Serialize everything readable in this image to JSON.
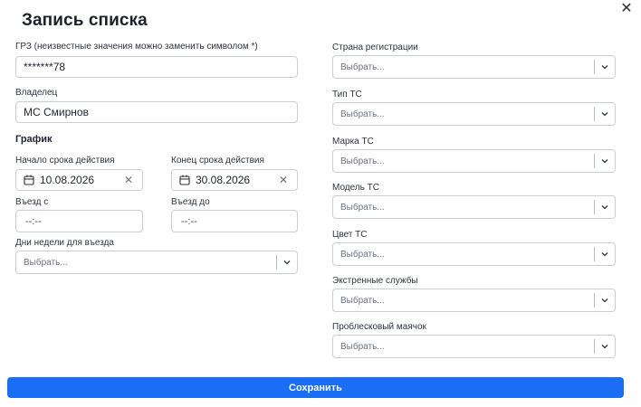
{
  "dialog": {
    "title": "Запись списка",
    "close_icon": "close-icon"
  },
  "left": {
    "plate": {
      "label": "ГРЗ (неизвестные значения можно заменить символом *)",
      "value": "*******78"
    },
    "owner": {
      "label": "Владелец",
      "value": "МС Смирнов"
    },
    "schedule": {
      "heading": "График",
      "start": {
        "label": "Начало срока действия",
        "value": "10.08.2026"
      },
      "end": {
        "label": "Конец срока действия",
        "value": "30.08.2026"
      },
      "entry_from": {
        "label": "Въезд с",
        "value": "--:--"
      },
      "entry_to": {
        "label": "Въезд до",
        "value": "--:--"
      },
      "weekdays": {
        "label": "Дни недели для въезда",
        "placeholder": "Выбрать..."
      }
    }
  },
  "right": {
    "fields": [
      {
        "label": "Страна регистрации",
        "placeholder": "Выбрать..."
      },
      {
        "label": "Тип ТС",
        "placeholder": "Выбрать..."
      },
      {
        "label": "Марка ТС",
        "placeholder": "Выбрать..."
      },
      {
        "label": "Модель ТС",
        "placeholder": "Выбрать..."
      },
      {
        "label": "Цвет ТС",
        "placeholder": "Выбрать..."
      },
      {
        "label": "Экстренные службы",
        "placeholder": "Выбрать..."
      },
      {
        "label": "Проблесковый маячок",
        "placeholder": "Выбрать..."
      }
    ]
  },
  "actions": {
    "save_label": "Сохранить"
  },
  "colors": {
    "accent": "#1a6ef5",
    "border": "#c9ced8"
  }
}
